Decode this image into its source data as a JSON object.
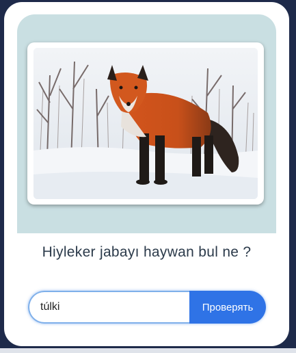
{
  "quiz": {
    "image_alt": "fox-photo",
    "question": "Hiyleker jabayı haywan bul ne ?",
    "answer_value": "túlki",
    "answer_placeholder": "",
    "submit_label": "Проверять"
  },
  "colors": {
    "page_background": "#1e2a4a",
    "card_background": "#ffffff",
    "image_area": "#c9dfe2",
    "button": "#2f73e6",
    "question_text": "#2b3a4a"
  }
}
